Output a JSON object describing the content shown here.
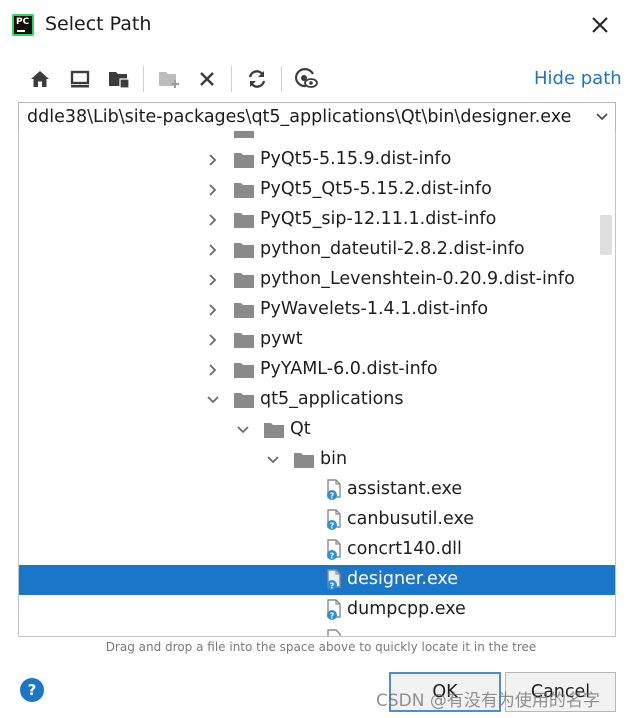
{
  "window": {
    "title": "Select Path",
    "logo_text": "PC",
    "colors": {
      "accent": "#1a76c8",
      "link": "#1f73c6",
      "selection": "#1a76c8"
    }
  },
  "toolbar": {
    "icons": [
      "home-icon",
      "desktop-icon",
      "project-folder-icon",
      "new-folder-icon",
      "delete-icon",
      "refresh-icon",
      "show-hidden-icon"
    ],
    "hide_path_label": "Hide path"
  },
  "path": {
    "value": "ddle38\\Lib\\site-packages\\qt5_applications\\Qt\\bin\\designer.exe"
  },
  "tree": {
    "items": [
      {
        "label": "PyQt5-5.15.9.dist-info",
        "type": "folder",
        "expanded": false
      },
      {
        "label": "PyQt5_Qt5-5.15.2.dist-info",
        "type": "folder",
        "expanded": false
      },
      {
        "label": "PyQt5_sip-12.11.1.dist-info",
        "type": "folder",
        "expanded": false
      },
      {
        "label": "python_dateutil-2.8.2.dist-info",
        "type": "folder",
        "expanded": false
      },
      {
        "label": "python_Levenshtein-0.20.9.dist-info",
        "type": "folder",
        "expanded": false
      },
      {
        "label": "PyWavelets-1.4.1.dist-info",
        "type": "folder",
        "expanded": false
      },
      {
        "label": "pywt",
        "type": "folder",
        "expanded": false
      },
      {
        "label": "PyYAML-6.0.dist-info",
        "type": "folder",
        "expanded": false
      },
      {
        "label": "qt5_applications",
        "type": "folder",
        "expanded": true
      },
      {
        "label": "Qt",
        "type": "folder",
        "expanded": true
      },
      {
        "label": "bin",
        "type": "folder",
        "expanded": true
      },
      {
        "label": "assistant.exe",
        "type": "file",
        "selected": false
      },
      {
        "label": "canbusutil.exe",
        "type": "file",
        "selected": false
      },
      {
        "label": "concrt140.dll",
        "type": "file",
        "selected": false
      },
      {
        "label": "designer.exe",
        "type": "file",
        "selected": true
      },
      {
        "label": "dumpcpp.exe",
        "type": "file",
        "selected": false
      }
    ]
  },
  "hint": "Drag and drop a file into the space above to quickly locate it in the tree",
  "footer": {
    "help_label": "?",
    "ok_label": "OK",
    "cancel_label": "Cancel",
    "watermark": "CSDN @有没有为使用的名字"
  }
}
